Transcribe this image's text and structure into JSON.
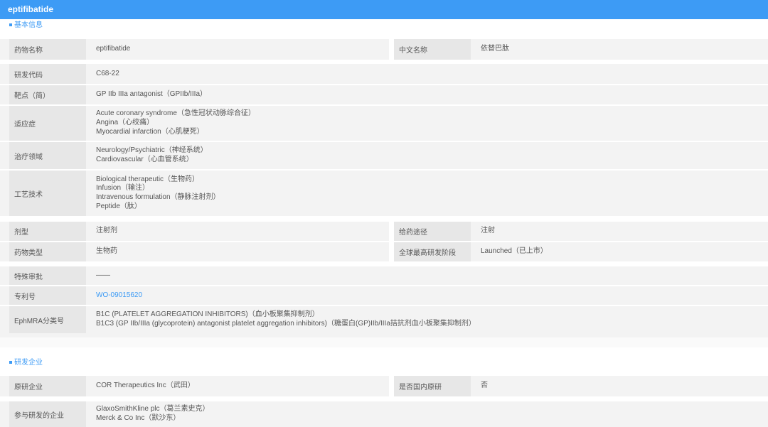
{
  "window": {
    "title": "eptifibatide"
  },
  "sections": {
    "basic": "基本信息",
    "company": "研发企业"
  },
  "rows": {
    "drug_name": {
      "label": "药物名称",
      "value": "eptifibatide"
    },
    "cn_name": {
      "label": "中文名称",
      "value": "依替巴肽"
    },
    "code": {
      "label": "研发代码",
      "value": "C68-22"
    },
    "target": {
      "label": "靶点（简）",
      "value": "GP IIb IIIa antagonist（GPIIb/IIIa）"
    },
    "indication": {
      "label": "适应症",
      "lines": [
        "Acute coronary syndrome（急性冠状动脉综合征）",
        "Angina（心绞痛）",
        "Myocardial infarction（心肌梗死）"
      ]
    },
    "therapy": {
      "label": "治疗领域",
      "lines": [
        "Neurology/Psychiatric（神经系统）",
        "Cardiovascular（心血管系统）"
      ]
    },
    "tech": {
      "label": "工艺技术",
      "lines": [
        "Biological therapeutic（生物药）",
        "Infusion（输注）",
        "Intravenous formulation（静脉注射剂）",
        "Peptide（肽）"
      ]
    },
    "dosage": {
      "label": "剂型",
      "value": "注射剂"
    },
    "route": {
      "label": "给药途径",
      "value": "注射"
    },
    "drug_type": {
      "label": "药物类型",
      "value": "生物药"
    },
    "stage": {
      "label": "全球最高研发阶段",
      "value": "Launched（已上市）"
    },
    "special": {
      "label": "特殊审批",
      "value": "——"
    },
    "patent": {
      "label": "专利号",
      "value": "WO-09015620"
    },
    "ephmra": {
      "label": "EphMRA分类号",
      "lines": [
        "B1C (PLATELET AGGREGATION INHIBITORS)（血小板聚集抑制剂）",
        "B1C3 (GP IIb/IIIa (glycoprotein) antagonist platelet aggregation inhibitors)（糖蛋白(GP)IIb/IIIa拮抗剂血小板聚集抑制剂）"
      ]
    },
    "orig": {
      "label": "原研企业",
      "value": "COR Therapeutics Inc（武田）"
    },
    "domestic": {
      "label": "是否国内原研",
      "value": "否"
    },
    "participants": {
      "label": "参与研发的企业",
      "lines": [
        "GlaxoSmithKline plc（葛兰素史克）",
        "Merck & Co Inc（默沙东）"
      ]
    }
  }
}
